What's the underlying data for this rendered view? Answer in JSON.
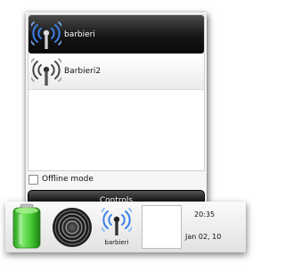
{
  "networks": [
    {
      "ssid": "barbieri",
      "selected": true,
      "icon": "wifi-signal-blue-icon"
    },
    {
      "ssid": "Barbieri2",
      "selected": false,
      "icon": "wifi-signal-grey-icon"
    }
  ],
  "offline_mode": {
    "label": "Offline mode",
    "checked": false
  },
  "controls_button": {
    "label": "Controls"
  },
  "taskbar": {
    "battery_icon": "battery-full-icon",
    "volume_icon": "speaker-icon",
    "network_tray": {
      "icon": "wifi-signal-blue-icon",
      "label": "barbieri"
    },
    "clock": {
      "time": "20:35",
      "date": "Jan 02, 10"
    }
  },
  "colors": {
    "battery_green": "#3fc42e",
    "wifi_blue": "#3a7fe6",
    "selected_bg": "#141414"
  }
}
